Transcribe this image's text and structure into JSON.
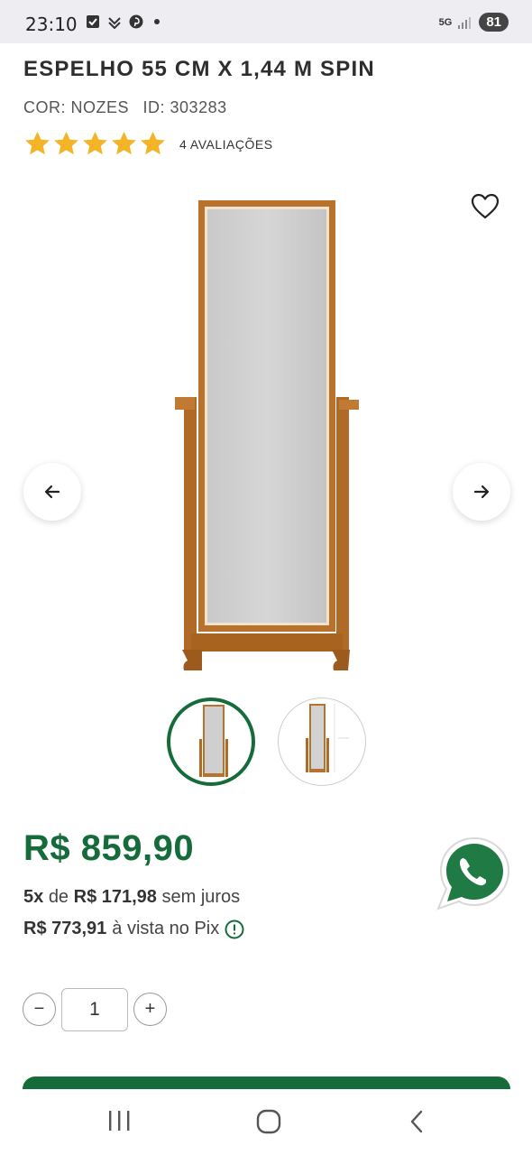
{
  "status_bar": {
    "time": "23:10",
    "network": "5G",
    "battery": "81"
  },
  "product": {
    "title": "ESPELHO 55 CM X 1,44 M SPIN",
    "color_label": "COR: NOZES",
    "id_label": "ID: 303283",
    "rating_stars": 5,
    "reviews_label": "4 AVALIAÇÕES"
  },
  "pricing": {
    "price": "R$ 859,90",
    "installments_count": "5x",
    "installments_of": "de",
    "installment_value": "R$ 171,98",
    "installments_suffix": "sem juros",
    "pix_value": "R$ 773,91",
    "pix_suffix": "à vista no Pix"
  },
  "quantity": {
    "minus": "−",
    "value": "1",
    "plus": "+"
  },
  "colors": {
    "brand_green": "#156b3a",
    "star": "#f4b428",
    "wood": "#b8722c",
    "whatsapp": "#1f7a43"
  },
  "icons": [
    "heart-icon",
    "arrow-left-icon",
    "arrow-right-icon",
    "whatsapp-icon",
    "info-icon",
    "star-icon"
  ]
}
